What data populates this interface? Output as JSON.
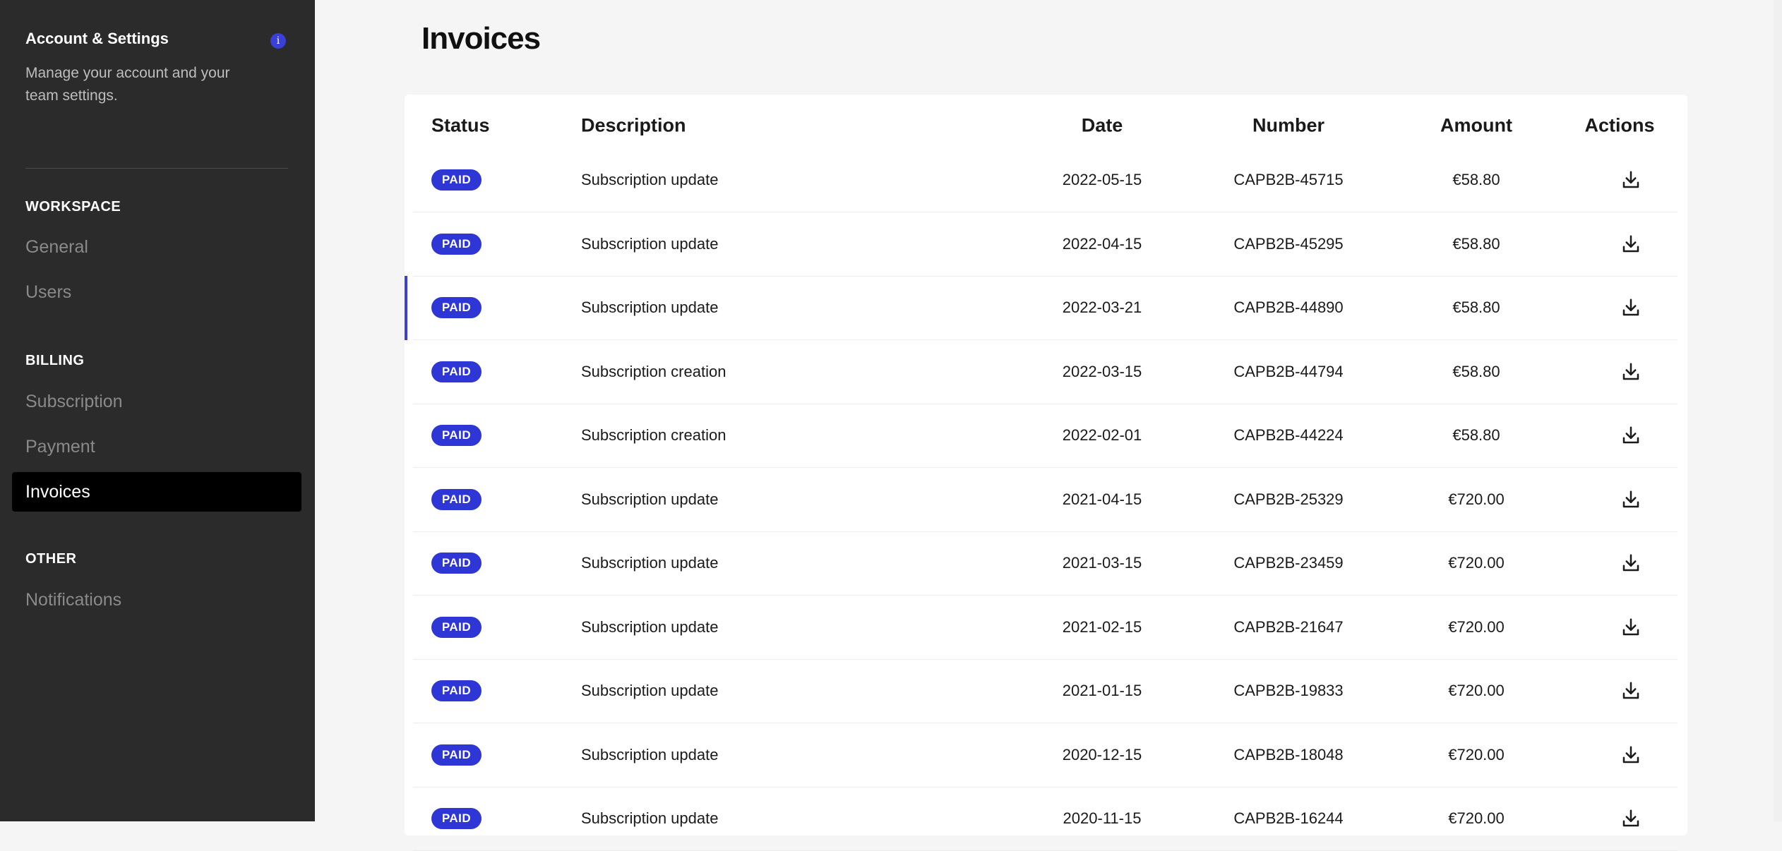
{
  "sidebar": {
    "title": "Account & Settings",
    "info_icon": "info-icon",
    "subtitle": "Manage your account and your team settings.",
    "sections": [
      {
        "label": "WORKSPACE",
        "items": [
          "General",
          "Users"
        ]
      },
      {
        "label": "BILLING",
        "items": [
          "Subscription",
          "Payment",
          "Invoices"
        ]
      },
      {
        "label": "OTHER",
        "items": [
          "Notifications"
        ]
      }
    ],
    "active_item": "Invoices"
  },
  "main": {
    "title": "Invoices",
    "columns": [
      "Status",
      "Description",
      "Date",
      "Number",
      "Amount",
      "Actions"
    ],
    "rows": [
      {
        "status": "PAID",
        "description": "Subscription update",
        "date": "2022-05-15",
        "number": "CAPB2B-45715",
        "amount": "€58.80"
      },
      {
        "status": "PAID",
        "description": "Subscription update",
        "date": "2022-04-15",
        "number": "CAPB2B-45295",
        "amount": "€58.80"
      },
      {
        "status": "PAID",
        "description": "Subscription update",
        "date": "2022-03-21",
        "number": "CAPB2B-44890",
        "amount": "€58.80"
      },
      {
        "status": "PAID",
        "description": "Subscription creation",
        "date": "2022-03-15",
        "number": "CAPB2B-44794",
        "amount": "€58.80"
      },
      {
        "status": "PAID",
        "description": "Subscription creation",
        "date": "2022-02-01",
        "number": "CAPB2B-44224",
        "amount": "€58.80"
      },
      {
        "status": "PAID",
        "description": "Subscription update",
        "date": "2021-04-15",
        "number": "CAPB2B-25329",
        "amount": "€720.00"
      },
      {
        "status": "PAID",
        "description": "Subscription update",
        "date": "2021-03-15",
        "number": "CAPB2B-23459",
        "amount": "€720.00"
      },
      {
        "status": "PAID",
        "description": "Subscription update",
        "date": "2021-02-15",
        "number": "CAPB2B-21647",
        "amount": "€720.00"
      },
      {
        "status": "PAID",
        "description": "Subscription update",
        "date": "2021-01-15",
        "number": "CAPB2B-19833",
        "amount": "€720.00"
      },
      {
        "status": "PAID",
        "description": "Subscription update",
        "date": "2020-12-15",
        "number": "CAPB2B-18048",
        "amount": "€720.00"
      },
      {
        "status": "PAID",
        "description": "Subscription update",
        "date": "2020-11-15",
        "number": "CAPB2B-16244",
        "amount": "€720.00"
      }
    ],
    "selected_row": 2,
    "status_color": "#2f36d6",
    "action_icon": "download-icon"
  }
}
